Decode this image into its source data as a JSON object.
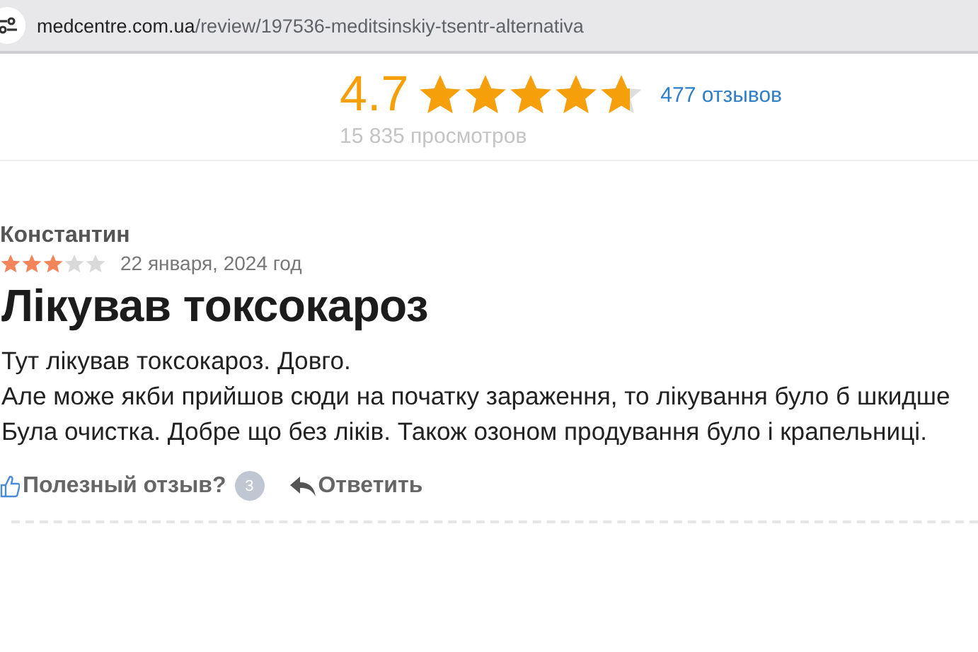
{
  "address_bar": {
    "domain": "medcentre.com.ua",
    "path": "/review/197536-meditsinskiy-tsentr-alternativa"
  },
  "rating": {
    "score": "4.7",
    "stars": 4.7,
    "reviews_link": "477 отзывов",
    "views": "15 835 просмотров"
  },
  "review": {
    "author": "Константин",
    "stars": 3,
    "date": "22 января, 2024 год",
    "title": "Лікував токсокароз",
    "lines": [
      "Тут лікував токсокароз. Довго.",
      "Але може якби прийшов сюди на початку зараження, то лікування було б шкидше",
      "Була очистка. Добре що без ліків. Також озоном продування було і крапельниці."
    ],
    "helpful": {
      "label": "Полезный отзыв?",
      "count": "3"
    },
    "reply": "Ответить"
  }
}
